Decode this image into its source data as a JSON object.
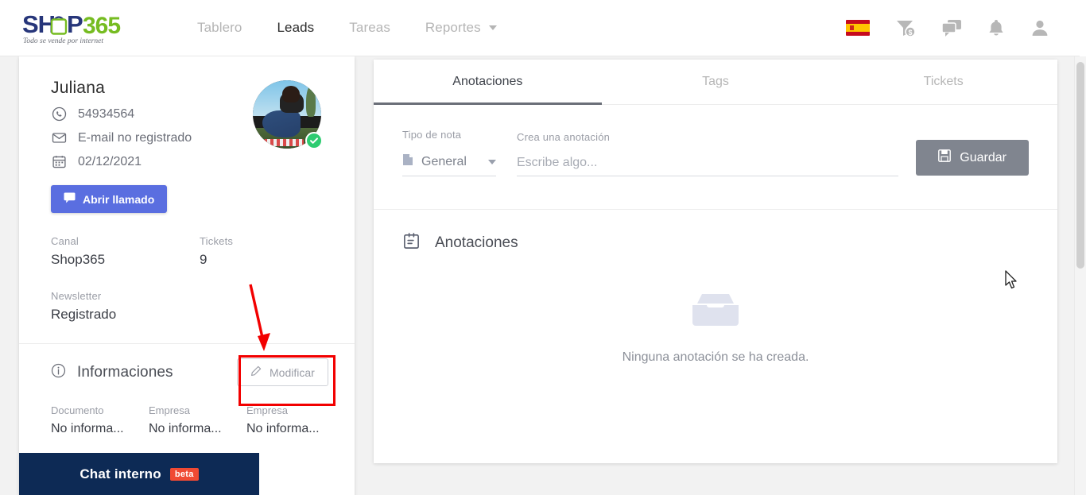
{
  "brand": {
    "name_shop": "SHOP",
    "name_365": "365",
    "tagline": "Todo se vende por internet",
    "color_blue": "#27367a",
    "color_green": "#76bc21"
  },
  "nav": {
    "links": [
      {
        "label": "Tablero",
        "active": false,
        "caret": false
      },
      {
        "label": "Leads",
        "active": true,
        "caret": false
      },
      {
        "label": "Tareas",
        "active": false,
        "caret": false
      },
      {
        "label": "Reportes",
        "active": false,
        "caret": true
      }
    ],
    "icons": [
      {
        "name": "flag-es-icon"
      },
      {
        "name": "funnel-money-icon"
      },
      {
        "name": "chat-bubbles-icon"
      },
      {
        "name": "bell-icon"
      },
      {
        "name": "user-account-icon"
      }
    ]
  },
  "lead": {
    "name": "Juliana",
    "phone": "54934564",
    "email": "E-mail no registrado",
    "date": "02/12/2021",
    "call_button": "Abrir llamado",
    "fields": [
      {
        "label": "Canal",
        "value": "Shop365"
      },
      {
        "label": "Tickets",
        "value": "9"
      },
      {
        "label": "Newsletter",
        "value": "Registrado"
      }
    ]
  },
  "informaciones": {
    "title": "Informaciones",
    "modify_button": "Modificar",
    "columns": [
      {
        "label": "Documento",
        "value": "No informa..."
      },
      {
        "label": "Empresa",
        "value": "No informa..."
      },
      {
        "label": "Empresa",
        "value": "No informa..."
      }
    ]
  },
  "chat": {
    "label": "Chat interno",
    "badge": "beta",
    "bar_color": "#0d2a55",
    "badge_color": "#f04a33"
  },
  "panel": {
    "tabs": [
      {
        "label": "Anotaciones",
        "active": true
      },
      {
        "label": "Tags",
        "active": false
      },
      {
        "label": "Tickets",
        "active": false
      }
    ],
    "form": {
      "type_label": "Tipo de nota",
      "type_value": "General",
      "note_label": "Crea una anotación",
      "note_placeholder": "Escribe algo...",
      "note_value": "",
      "save_label": "Guardar"
    },
    "section_title": "Anotaciones",
    "empty_text": "Ninguna anotación se ha creada."
  },
  "annotation": {
    "arrow_color": "#f20000",
    "highlight_color": "#f20000"
  }
}
